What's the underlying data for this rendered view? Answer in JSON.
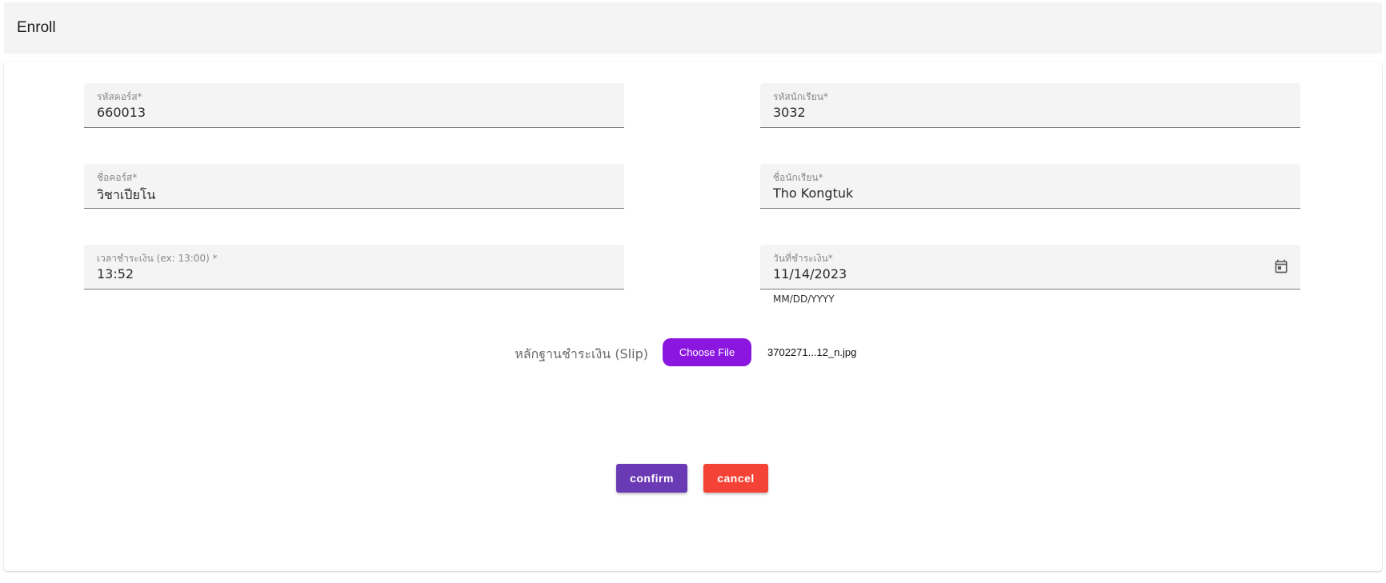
{
  "header": {
    "title": "Enroll"
  },
  "form": {
    "course_code": {
      "label": "รหัสคอร์ส*",
      "value": "660013"
    },
    "student_id": {
      "label": "รหัสนักเรียน*",
      "value": "3032"
    },
    "course_name": {
      "label": "ชื่อคอร์ส*",
      "value": "วิชาเปียโน"
    },
    "student_name": {
      "label": "ชื่อนักเรียน*",
      "value": "Tho Kongtuk"
    },
    "payment_time": {
      "label": "เวลาชำระเงิน (ex: 13:00) *",
      "value": "13:52"
    },
    "payment_date": {
      "label": "วันที่ชำระเงิน*",
      "value": "11/14/2023",
      "helper": "MM/DD/YYYY",
      "icon": "calendar-icon"
    },
    "slip": {
      "label": "หลักฐานชำระเงิน (Slip)",
      "button_label": "Choose File",
      "file_name": "3702271...12_n.jpg"
    }
  },
  "actions": {
    "confirm_label": "confirm",
    "cancel_label": "cancel"
  },
  "colors": {
    "file_button": "#8a16e0",
    "confirm": "#6a3ab5",
    "cancel": "#f44336",
    "field_bg": "#f4f4f4"
  }
}
